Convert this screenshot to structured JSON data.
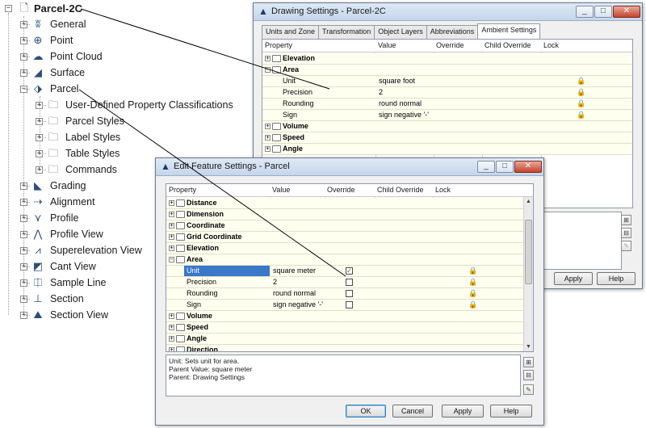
{
  "tree": {
    "root": {
      "label": "Parcel-2C",
      "icon": "drawing-icon"
    },
    "items": [
      {
        "label": "General",
        "icon": "general-icon"
      },
      {
        "label": "Point",
        "icon": "point-icon"
      },
      {
        "label": "Point Cloud",
        "icon": "point-cloud-icon"
      },
      {
        "label": "Surface",
        "icon": "surface-icon"
      },
      {
        "label": "Parcel",
        "icon": "parcel-icon",
        "expanded": true,
        "children": [
          {
            "label": "User-Defined Property Classifications",
            "icon": "folder-icon"
          },
          {
            "label": "Parcel Styles",
            "icon": "folder-icon"
          },
          {
            "label": "Label Styles",
            "icon": "folder-icon"
          },
          {
            "label": "Table Styles",
            "icon": "folder-icon"
          },
          {
            "label": "Commands",
            "icon": "folder-icon"
          }
        ]
      },
      {
        "label": "Grading",
        "icon": "grading-icon"
      },
      {
        "label": "Alignment",
        "icon": "alignment-icon"
      },
      {
        "label": "Profile",
        "icon": "profile-icon"
      },
      {
        "label": "Profile View",
        "icon": "profile-view-icon"
      },
      {
        "label": "Superelevation View",
        "icon": "superelevation-view-icon"
      },
      {
        "label": "Cant View",
        "icon": "cant-view-icon"
      },
      {
        "label": "Sample Line",
        "icon": "sample-line-icon"
      },
      {
        "label": "Section",
        "icon": "section-icon"
      },
      {
        "label": "Section View",
        "icon": "section-view-icon"
      }
    ]
  },
  "drawing_settings": {
    "title": "Drawing Settings - Parcel-2C",
    "tabs": [
      "Units and Zone",
      "Transformation",
      "Object Layers",
      "Abbreviations",
      "Ambient Settings"
    ],
    "active_tab": "Ambient Settings",
    "columns": [
      "Property",
      "Value",
      "Override",
      "Child Override",
      "Lock"
    ],
    "rows": [
      {
        "kind": "category",
        "label": "Elevation",
        "expanded": false
      },
      {
        "kind": "category",
        "label": "Area",
        "expanded": true
      },
      {
        "kind": "prop",
        "label": "Unit",
        "value": "square foot",
        "lock": true
      },
      {
        "kind": "prop",
        "label": "Precision",
        "value": "2",
        "lock": true
      },
      {
        "kind": "prop",
        "label": "Rounding",
        "value": "round normal",
        "lock": true
      },
      {
        "kind": "prop",
        "label": "Sign",
        "value": "sign negative '-'",
        "lock": true
      },
      {
        "kind": "category",
        "label": "Volume",
        "expanded": false
      },
      {
        "kind": "category",
        "label": "Speed",
        "expanded": false
      },
      {
        "kind": "category",
        "label": "Angle",
        "expanded": false
      }
    ],
    "buttons": {
      "apply": "Apply",
      "help": "Help"
    }
  },
  "edit_feature_settings": {
    "title": "Edit Feature Settings - Parcel",
    "columns": [
      "Property",
      "Value",
      "Override",
      "Child Override",
      "Lock"
    ],
    "rows": [
      {
        "kind": "category",
        "label": "Distance"
      },
      {
        "kind": "category",
        "label": "Dimension"
      },
      {
        "kind": "category",
        "label": "Coordinate"
      },
      {
        "kind": "category",
        "label": "Grid Coordinate"
      },
      {
        "kind": "category",
        "label": "Elevation"
      },
      {
        "kind": "category",
        "label": "Area",
        "expanded": true
      },
      {
        "kind": "prop",
        "label": "Unit",
        "value": "square meter",
        "override": true,
        "lock": true,
        "selected": true
      },
      {
        "kind": "prop",
        "label": "Precision",
        "value": "2",
        "override": false,
        "lock": true
      },
      {
        "kind": "prop",
        "label": "Rounding",
        "value": "round normal",
        "override": false,
        "lock": true
      },
      {
        "kind": "prop",
        "label": "Sign",
        "value": "sign negative '-'",
        "override": false,
        "lock": true
      },
      {
        "kind": "category",
        "label": "Volume"
      },
      {
        "kind": "category",
        "label": "Speed"
      },
      {
        "kind": "category",
        "label": "Angle"
      },
      {
        "kind": "category",
        "label": "Direction"
      }
    ],
    "description": [
      "Unit: Sets unit for area.",
      "Parent Value: square meter",
      "Parent: Drawing Settings"
    ],
    "buttons": {
      "ok": "OK",
      "cancel": "Cancel",
      "apply": "Apply",
      "help": "Help"
    }
  }
}
